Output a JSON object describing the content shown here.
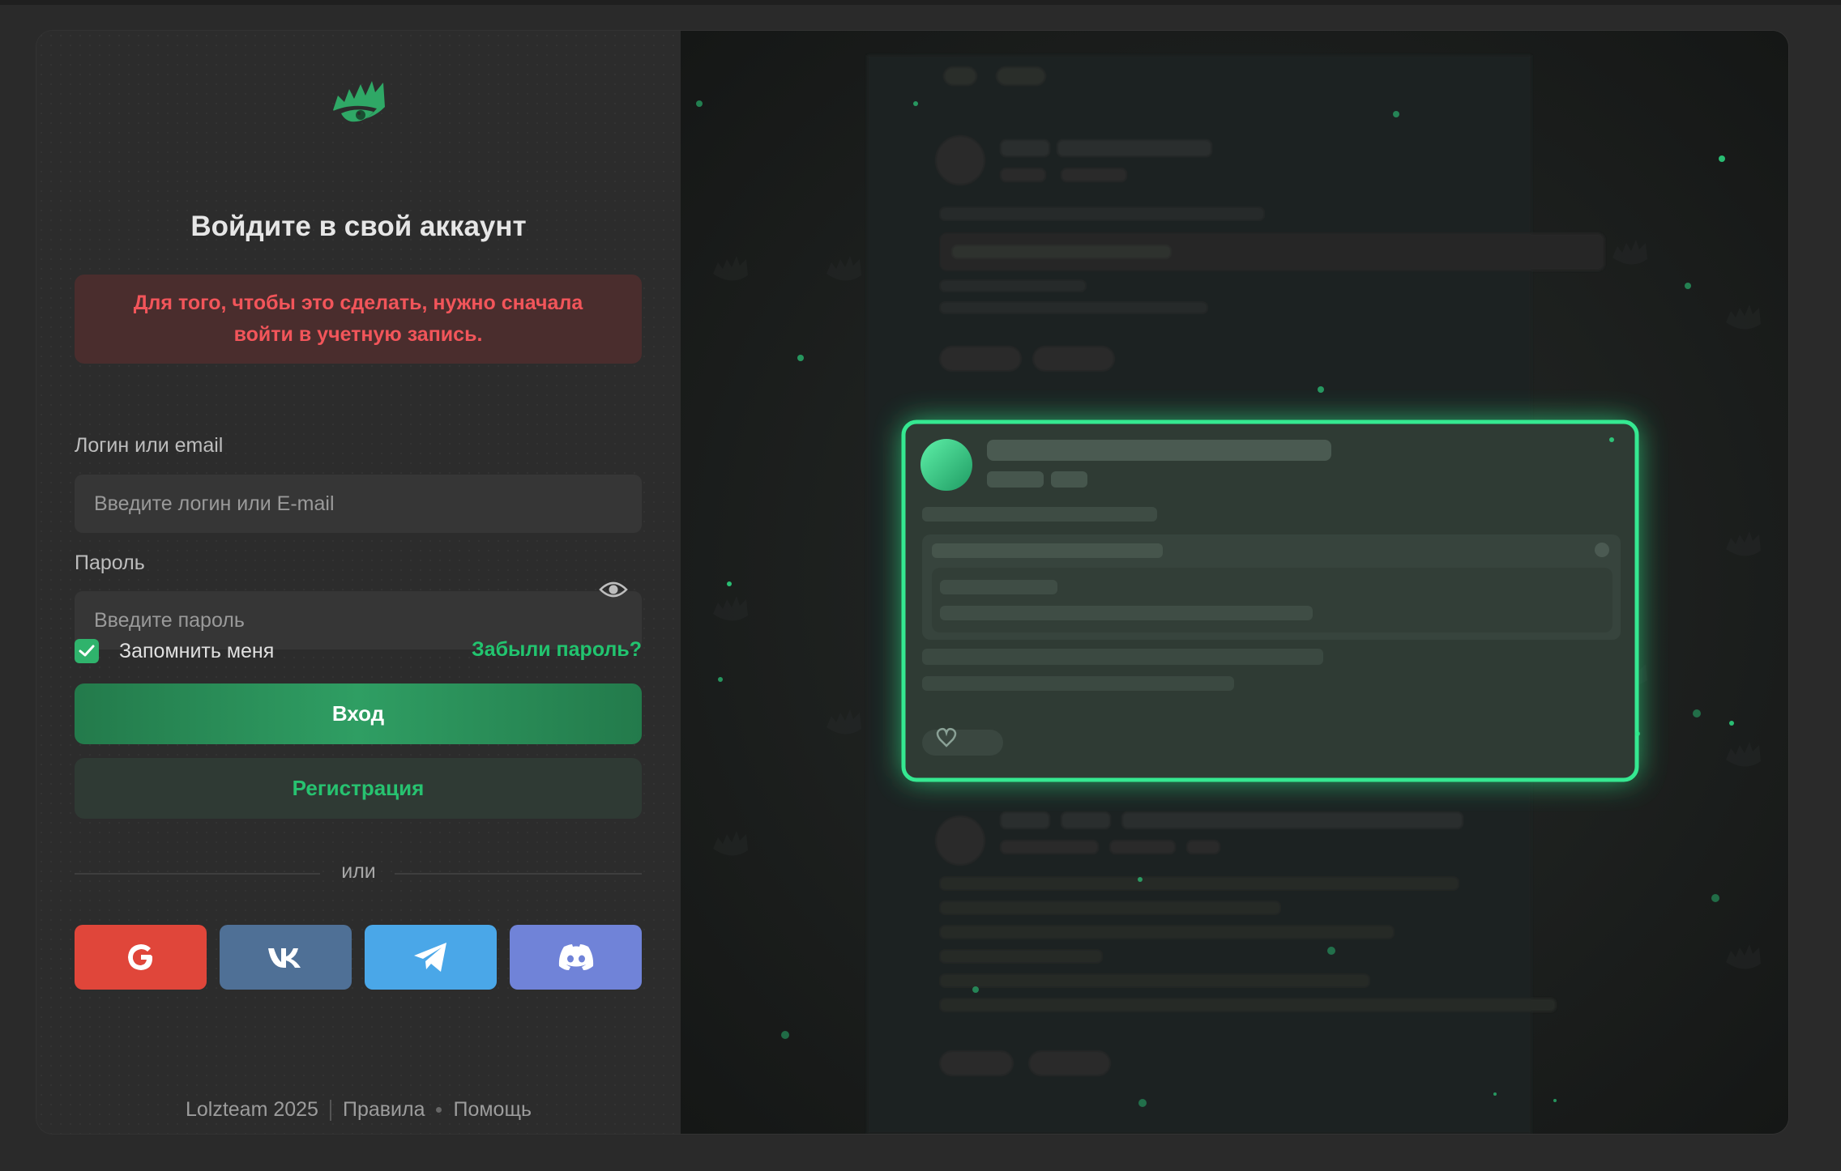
{
  "login": {
    "title": "Войдите в свой аккаунт",
    "alert": "Для того, чтобы это сделать, нужно сначала войти в учетную запись.",
    "username_label": "Логин или email",
    "username_placeholder": "Введите логин или E-mail",
    "password_label": "Пароль",
    "password_placeholder": "Введите пароль",
    "remember_label": "Запомнить меня",
    "remember_checked": true,
    "forgot_label": "Забыли пароль?",
    "login_button": "Вход",
    "register_button": "Регистрация",
    "or_label": "или"
  },
  "social": [
    {
      "name": "google",
      "icon": "google-icon",
      "color": "#e0463a"
    },
    {
      "name": "vk",
      "icon": "vk-icon",
      "color": "#4f7096"
    },
    {
      "name": "telegram",
      "icon": "telegram-icon",
      "color": "#4aa7e8"
    },
    {
      "name": "discord",
      "icon": "discord-icon",
      "color": "#7083d8"
    }
  ],
  "footer": {
    "copyright": "Lolzteam 2025",
    "rules": "Правила",
    "help": "Помощь"
  },
  "colors": {
    "accent": "#22c46f",
    "alert_text": "#f2555a",
    "alert_bg": "#4a2d2d",
    "panel_bg": "#2c2c2c"
  }
}
